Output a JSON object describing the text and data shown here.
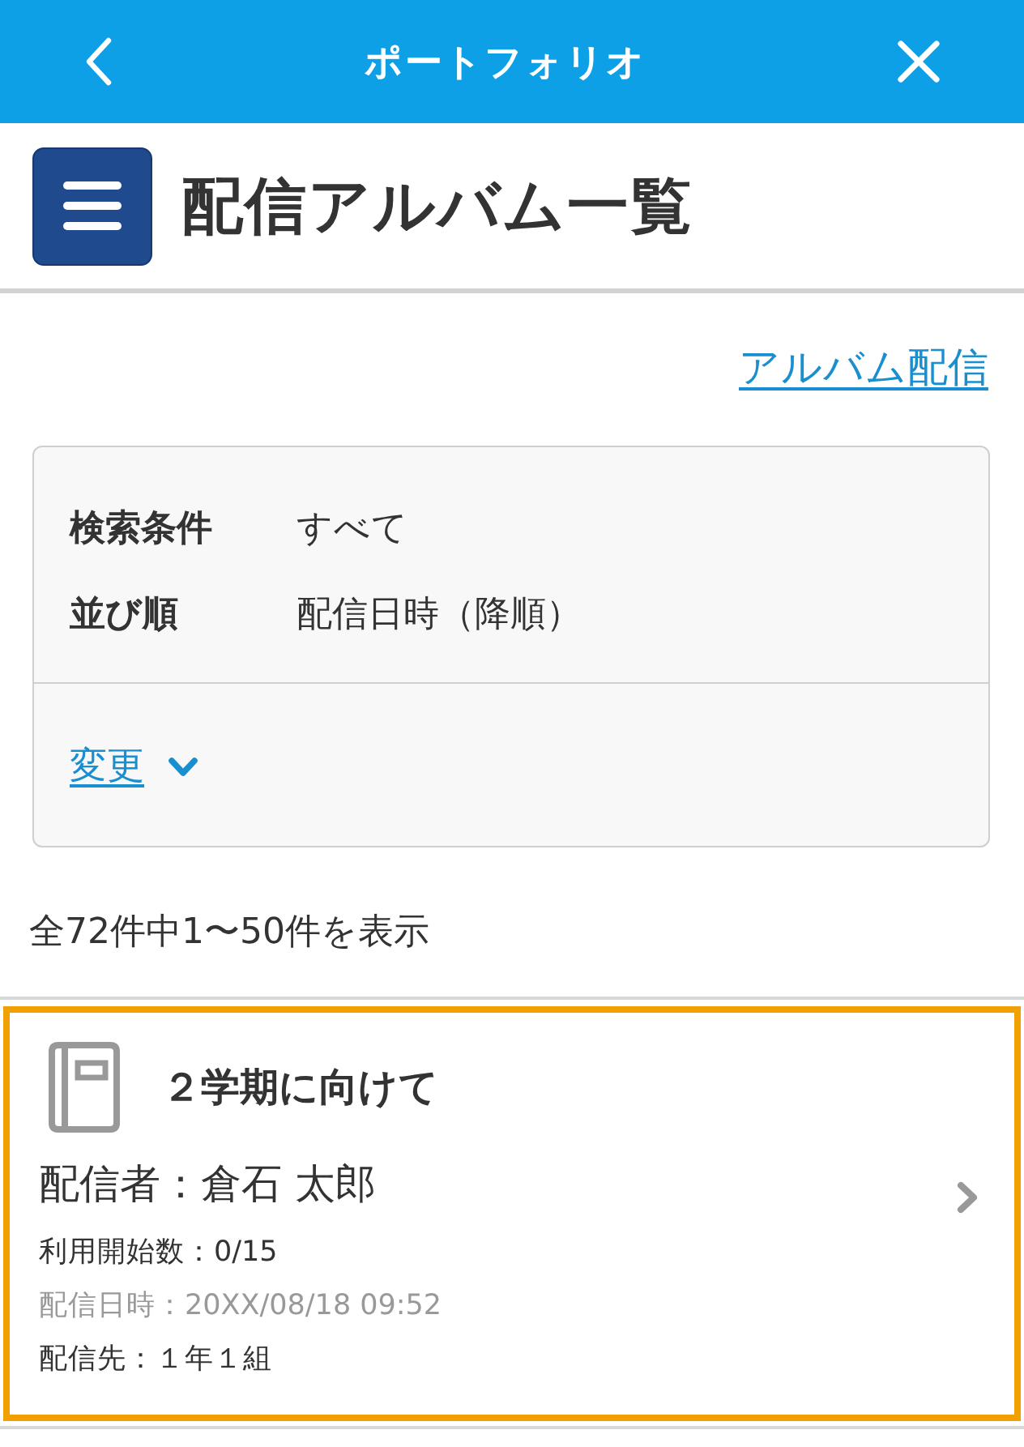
{
  "header": {
    "title": "ポートフォリオ"
  },
  "page_title": "配信アルバム一覧",
  "distribute_link": "アルバム配信",
  "filter": {
    "rows": [
      {
        "label": "検索条件",
        "value": "すべて"
      },
      {
        "label": "並び順",
        "value": "配信日時（降順）"
      }
    ],
    "change_link": "変更",
    "expanded": false
  },
  "result_count": "全72件中1〜50件を表示",
  "albums": [
    {
      "title": "２学期に向けて",
      "sender": "配信者：倉石 太郎",
      "details": [
        {
          "kind": "normal",
          "text": "利用開始数：0/15"
        },
        {
          "kind": "muted",
          "text": "配信日時：20XX/08/18 09:52"
        },
        {
          "kind": "normal",
          "text": "配信先：１年１組"
        }
      ],
      "highlighted": true
    }
  ]
}
